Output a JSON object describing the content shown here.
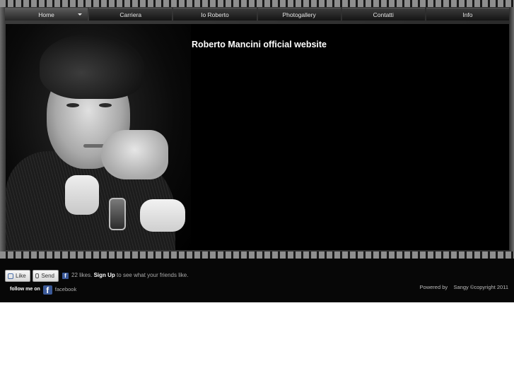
{
  "nav": {
    "items": [
      {
        "label": "Home",
        "active": true
      },
      {
        "label": "Carriera"
      },
      {
        "label": "Io Roberto"
      },
      {
        "label": "Photogallery"
      },
      {
        "label": "Contatti"
      },
      {
        "label": "Info"
      }
    ]
  },
  "main": {
    "title": "Roberto Mancini official website"
  },
  "footer": {
    "like_label": "Like",
    "send_label": "Send",
    "likes_count": "22 likes.",
    "signup_label": "Sign Up",
    "signup_tail": "to see what your friends like.",
    "follow_label": "follow me on",
    "facebook_label": "facebook",
    "powered_by": "Powered by",
    "credit": "Sangy ©copyright 2011"
  },
  "icons": {
    "facebook_color": "#3b5998"
  }
}
